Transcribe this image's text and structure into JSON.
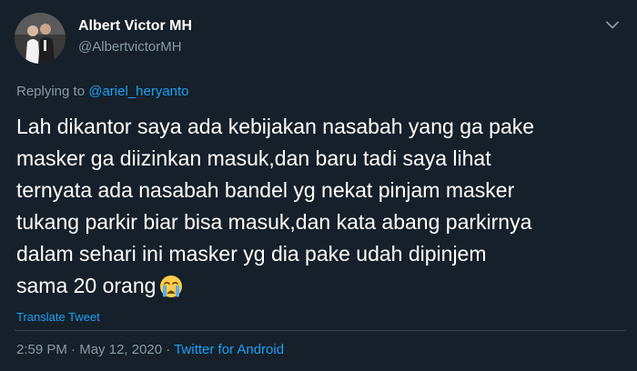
{
  "user": {
    "display_name": "Albert Victor MH",
    "handle": "@AlbertvictorMH"
  },
  "reply": {
    "prefix": "Replying to ",
    "handle": "@ariel_heryanto"
  },
  "tweet": {
    "lines": [
      "Lah dikantor saya ada kebijakan nasabah yang ga pake",
      "masker ga diizinkan masuk,dan baru tadi saya lihat",
      "ternyata ada nasabah bandel yg nekat pinjam masker",
      "tukang parkir biar bisa masuk,dan kata abang parkirnya",
      "dalam sehari ini masker yg dia pake udah dipinjem",
      "sama 20 orang"
    ],
    "emoji": "loudly-crying-face-emoji"
  },
  "translate_label": "Translate Tweet",
  "meta": {
    "time": "2:59 PM",
    "date": "May 12, 2020",
    "separator": " · ",
    "source": "Twitter for Android"
  },
  "icons": {
    "more": "chevron-down-icon"
  },
  "colors": {
    "background": "#15202b",
    "text": "#ffffff",
    "muted": "#8899a6",
    "accent": "#1da1f2",
    "divider": "#38444d"
  }
}
